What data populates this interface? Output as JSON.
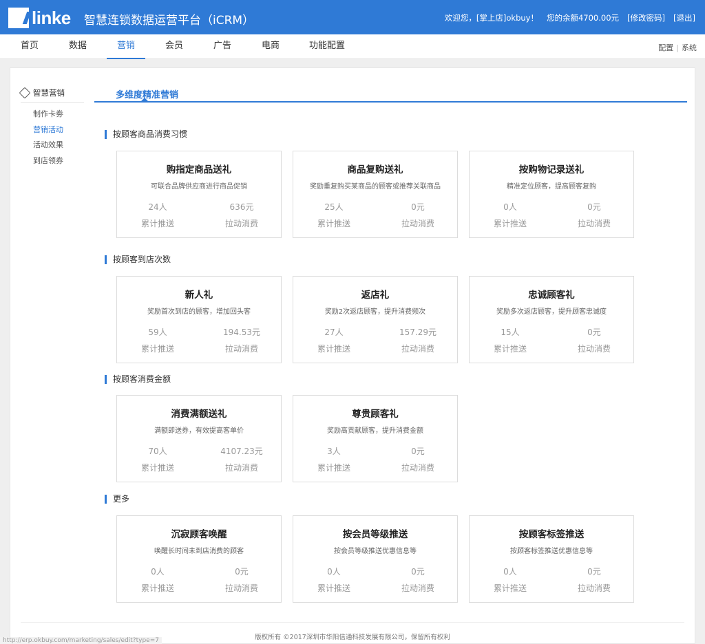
{
  "header": {
    "logo_text": "linke",
    "app_title": "智慧连锁数据运营平台（iCRM）",
    "welcome": "欢迎您，[掌上店]okbuy！",
    "balance": "您的余额4700.00元",
    "change_password": "[修改密码]",
    "logout": "[退出]"
  },
  "nav": {
    "items": [
      "首页",
      "数据",
      "营销",
      "会员",
      "广告",
      "电商",
      "功能配置"
    ],
    "right_config": "配置",
    "right_system": "系统"
  },
  "sidebar": {
    "heading": "智慧营销",
    "items": [
      "制作卡劵",
      "营销活动",
      "活动效果",
      "到店领券"
    ]
  },
  "tab": {
    "title": "多维度精准营销"
  },
  "sections": [
    {
      "title": "按顾客商品消费习惯",
      "cards": [
        {
          "title": "购指定商品送礼",
          "desc": "可联合品牌供应商进行商品促销",
          "pushed": "24人",
          "consumption": "636元"
        },
        {
          "title": "商品复购送礼",
          "desc": "奖励重复购买某商品的顾客或推荐关联商品",
          "pushed": "25人",
          "consumption": "0元"
        },
        {
          "title": "按购物记录送礼",
          "desc": "精准定位顾客，提高顾客复购",
          "pushed": "0人",
          "consumption": "0元"
        }
      ]
    },
    {
      "title": "按顾客到店次数",
      "cards": [
        {
          "title": "新人礼",
          "desc": "奖励首次到店的顾客，增加回头客",
          "pushed": "59人",
          "consumption": "194.53元"
        },
        {
          "title": "返店礼",
          "desc": "奖励2次返店顾客，提升消费频次",
          "pushed": "27人",
          "consumption": "157.29元"
        },
        {
          "title": "忠诚顾客礼",
          "desc": "奖励多次返店顾客，提升顾客忠诚度",
          "pushed": "15人",
          "consumption": "0元"
        }
      ]
    },
    {
      "title": "按顾客消费金额",
      "cards": [
        {
          "title": "消费满额送礼",
          "desc": "满额即送券，有效提高客单价",
          "pushed": "70人",
          "consumption": "4107.23元"
        },
        {
          "title": "尊贵顾客礼",
          "desc": "奖励高贡献顾客，提升消费金额",
          "pushed": "3人",
          "consumption": "0元"
        }
      ]
    },
    {
      "title": "更多",
      "cards": [
        {
          "title": "沉寂顾客唤醒",
          "desc": "唤醒长时间未到店消费的顾客",
          "pushed": "0人",
          "consumption": "0元"
        },
        {
          "title": "按会员等级推送",
          "desc": "按会员等级推送优惠信息等",
          "pushed": "0人",
          "consumption": "0元"
        },
        {
          "title": "按顾客标签推送",
          "desc": "按顾客标签推送优惠信息等",
          "pushed": "0人",
          "consumption": "0元"
        }
      ]
    }
  ],
  "stat_labels": {
    "pushed": "累计推送",
    "consumption": "拉动消费"
  },
  "footer": {
    "copyright": "版权所有 ©2017深圳市华阳信通科技发展有限公司，保留所有权利"
  },
  "status_url": "http://erp.okbuy.com/marketing/sales/edit?type=7",
  "colors": {
    "accent": "#2f7ad6",
    "muted": "#999999"
  }
}
